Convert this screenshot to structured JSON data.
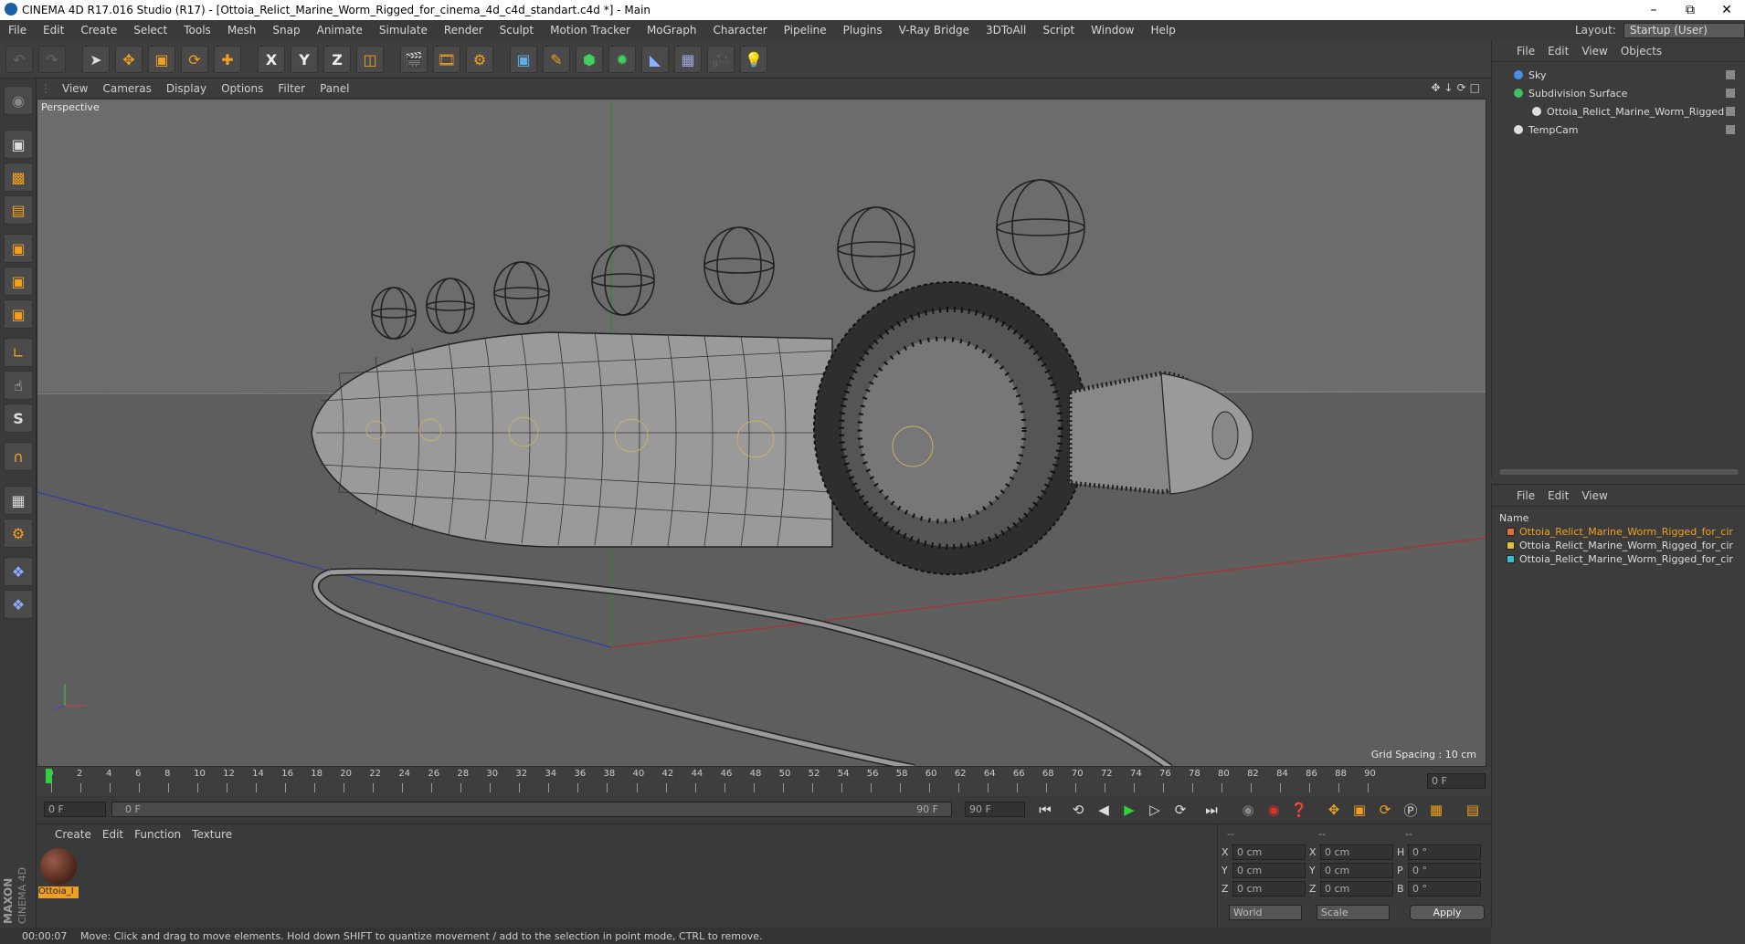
{
  "window": {
    "title": "CINEMA 4D R17.016 Studio (R17) - [Ottoia_Relict_Marine_Worm_Rigged_for_cinema_4d_c4d_standart.c4d *] - Main"
  },
  "menubar": [
    "File",
    "Edit",
    "Create",
    "Select",
    "Tools",
    "Mesh",
    "Snap",
    "Animate",
    "Simulate",
    "Render",
    "Sculpt",
    "Motion Tracker",
    "MoGraph",
    "Character",
    "Pipeline",
    "Plugins",
    "V-Ray Bridge",
    "3DToAll",
    "Script",
    "Window",
    "Help"
  ],
  "layout": {
    "label": "Layout:",
    "value": "Startup (User)"
  },
  "viewport": {
    "menu": [
      "View",
      "Cameras",
      "Display",
      "Options",
      "Filter",
      "Panel"
    ],
    "label": "Perspective",
    "grid_spacing": "Grid Spacing : 10 cm"
  },
  "timeline": {
    "ticks": [
      "0",
      "2",
      "4",
      "6",
      "8",
      "10",
      "12",
      "14",
      "16",
      "18",
      "20",
      "22",
      "24",
      "26",
      "28",
      "30",
      "32",
      "34",
      "36",
      "38",
      "40",
      "42",
      "44",
      "46",
      "48",
      "50",
      "52",
      "54",
      "56",
      "58",
      "60",
      "62",
      "64",
      "66",
      "68",
      "70",
      "72",
      "74",
      "76",
      "78",
      "80",
      "82",
      "84",
      "86",
      "88",
      "90"
    ],
    "end_frame": "0 F"
  },
  "transport": {
    "current": "0 F",
    "range_start": "0 F",
    "range_end": "90 F",
    "max": "90 F"
  },
  "material_panel": {
    "menu": [
      "Create",
      "Edit",
      "Function",
      "Texture"
    ],
    "material_name": "Ottoia_I"
  },
  "coords": {
    "headers": [
      "--",
      "--",
      "--"
    ],
    "rows": [
      {
        "a": "X",
        "av": "0 cm",
        "b": "X",
        "bv": "0 cm",
        "c": "H",
        "cv": "0 °"
      },
      {
        "a": "Y",
        "av": "0 cm",
        "b": "Y",
        "bv": "0 cm",
        "c": "P",
        "cv": "0 °"
      },
      {
        "a": "Z",
        "av": "0 cm",
        "b": "Z",
        "bv": "0 cm",
        "c": "B",
        "cv": "0 °"
      }
    ],
    "world": "World",
    "scale": "Scale",
    "apply": "Apply"
  },
  "status": {
    "time": "00:00:07",
    "message": "Move: Click and drag to move elements. Hold down SHIFT to quantize movement / add to the selection in point mode, CTRL to remove."
  },
  "object_manager": {
    "menu": [
      "File",
      "Edit",
      "View",
      "Objects"
    ],
    "objects": [
      "Sky",
      "Subdivision Surface",
      "Ottoia_Relict_Marine_Worm_Rigged",
      "TempCam"
    ]
  },
  "material_manager": {
    "menu": [
      "File",
      "Edit",
      "View"
    ],
    "column": "Name",
    "items": [
      {
        "name": "Ottoia_Relict_Marine_Worm_Rigged_for_cir",
        "color": "#e07030",
        "selected": true
      },
      {
        "name": "Ottoia_Relict_Marine_Worm_Rigged_for_cir",
        "color": "#e0c030",
        "selected": false
      },
      {
        "name": "Ottoia_Relict_Marine_Worm_Rigged_for_cir",
        "color": "#30c0d0",
        "selected": false
      }
    ]
  },
  "logo": {
    "brand": "MAXON",
    "product": "CINEMA 4D"
  }
}
